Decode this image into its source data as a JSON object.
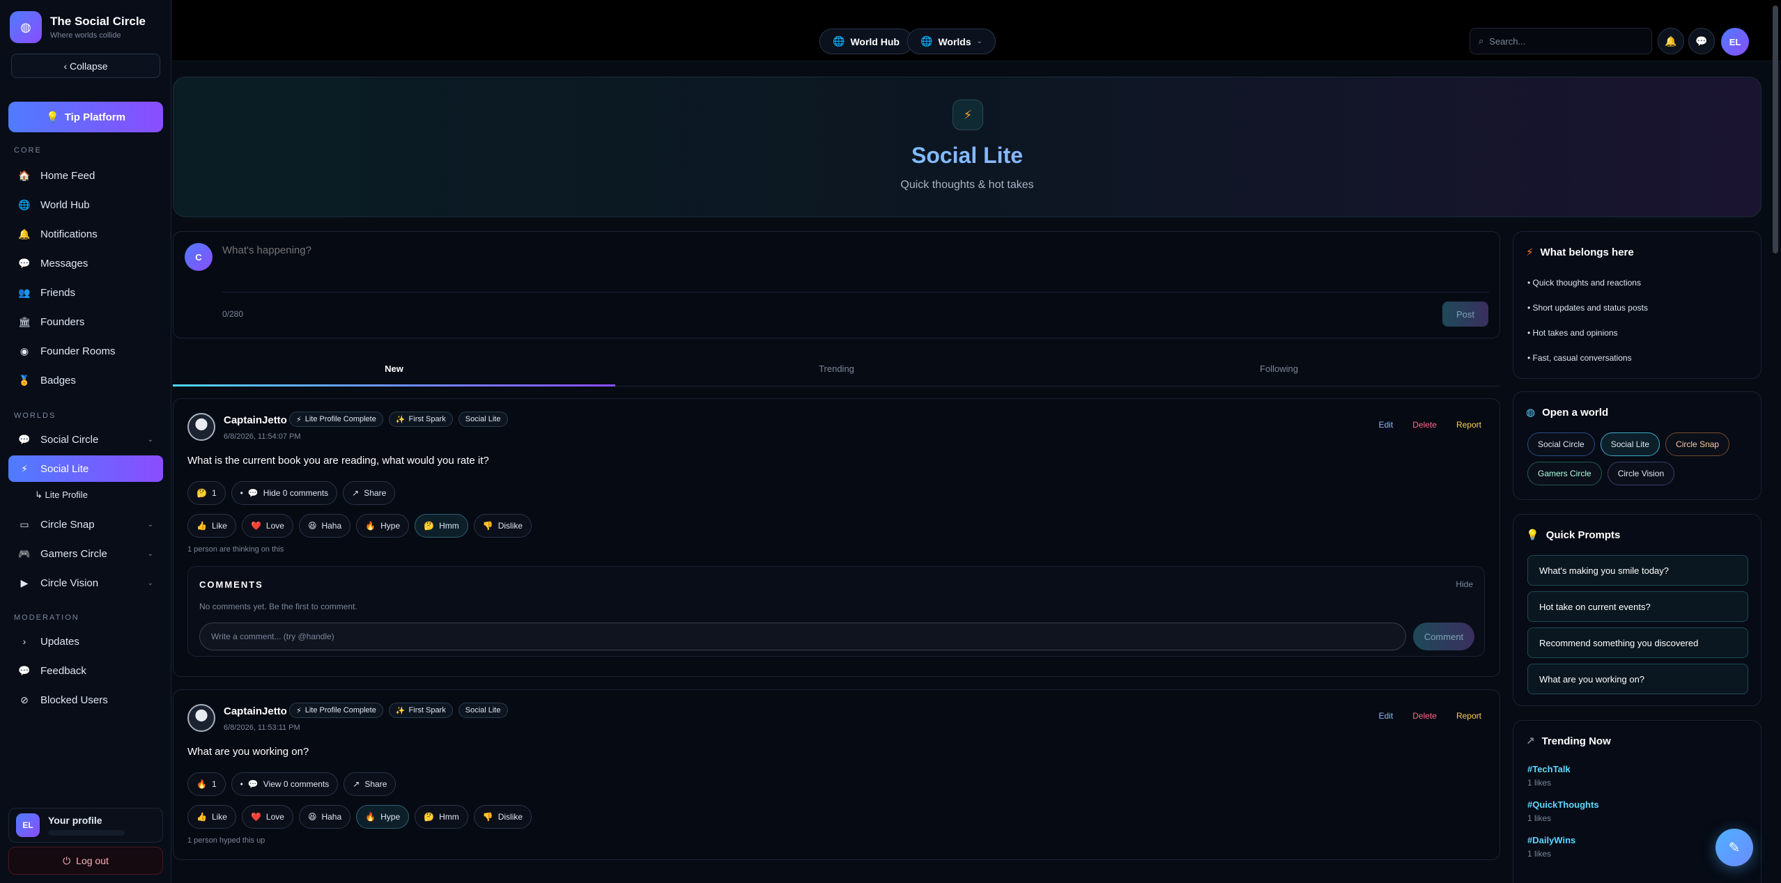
{
  "brand": {
    "title": "The Social Circle",
    "subtitle": "Where worlds collide"
  },
  "sidebar": {
    "collapse_label": "‹ Collapse",
    "tip_label": "Tip Platform",
    "sections": {
      "core": "CORE",
      "worlds": "WORLDS",
      "moderation": "MODERATION"
    },
    "core_items": [
      {
        "label": "Home Feed",
        "icon": "🏠"
      },
      {
        "label": "World Hub",
        "icon": "🌐"
      },
      {
        "label": "Notifications",
        "icon": "🔔"
      },
      {
        "label": "Messages",
        "icon": "💬"
      },
      {
        "label": "Friends",
        "icon": "👥"
      },
      {
        "label": "Founders",
        "icon": "🏛"
      },
      {
        "label": "Founder Rooms",
        "icon": "◉"
      },
      {
        "label": "Badges",
        "icon": "🏅"
      }
    ],
    "world_items": [
      {
        "label": "Social Circle",
        "icon": "💬"
      },
      {
        "label": "Social Lite",
        "icon": "⚡"
      },
      {
        "label": "Circle Snap",
        "icon": "▭"
      },
      {
        "label": "Gamers Circle",
        "icon": "🎮"
      },
      {
        "label": "Circle Vision",
        "icon": "▶"
      }
    ],
    "sub_item": "↳ Lite Profile",
    "mod_items": [
      {
        "label": "Updates",
        "icon": "›"
      },
      {
        "label": "Feedback",
        "icon": "💬"
      },
      {
        "label": "Blocked Users",
        "icon": "⊘"
      }
    ],
    "profile": {
      "initials": "EL",
      "label": "Your profile"
    },
    "logout_label": "Log out"
  },
  "topbar": {
    "world_hub": "World Hub",
    "worlds": "Worlds",
    "search_placeholder": "Search...",
    "avatar_initials": "EL"
  },
  "hero": {
    "title": "Social Lite",
    "subtitle": "Quick thoughts & hot takes"
  },
  "composer": {
    "avatar": "C",
    "placeholder": "What's happening?",
    "counter": "0/280",
    "post_label": "Post"
  },
  "tabs": [
    "New",
    "Trending",
    "Following"
  ],
  "posts": [
    {
      "author": "CaptainJetto",
      "badges": [
        "Lite Profile Complete",
        "First Spark",
        "Social Lite"
      ],
      "time": "6/8/2026, 11:54:07 PM",
      "actions": {
        "edit": "Edit",
        "delete": "Delete",
        "report": "Report"
      },
      "text": "What is the current book you are reading, what would you rate it?",
      "reaction_count": "1",
      "comments_toggle": "Hide 0 comments",
      "share": "Share",
      "reactions": [
        "Like",
        "Love",
        "Haha",
        "Hype",
        "Hmm",
        "Dislike"
      ],
      "meta": "1 person are thinking on this",
      "comments": {
        "title": "COMMENTS",
        "hide": "Hide",
        "empty": "No comments yet. Be the first to comment.",
        "placeholder": "Write a comment... (try @handle)",
        "button": "Comment"
      }
    },
    {
      "author": "CaptainJetto",
      "badges": [
        "Lite Profile Complete",
        "First Spark",
        "Social Lite"
      ],
      "time": "6/8/2026, 11:53:11 PM",
      "actions": {
        "edit": "Edit",
        "delete": "Delete",
        "report": "Report"
      },
      "text": "What are you working on?",
      "reaction_count": "1",
      "comments_toggle": "View 0 comments",
      "share": "Share",
      "reactions": [
        "Like",
        "Love",
        "Haha",
        "Hype",
        "Hmm",
        "Dislike"
      ],
      "meta": "1 person hyped this up"
    }
  ],
  "panels": {
    "belongs": {
      "title": "What belongs here",
      "items": [
        "• Quick thoughts and reactions",
        "• Short updates and status posts",
        "• Hot takes and opinions",
        "• Fast, casual conversations"
      ]
    },
    "open_world": {
      "title": "Open a world",
      "worlds": [
        "Social Circle",
        "Social Lite",
        "Circle Snap",
        "Gamers Circle",
        "Circle Vision"
      ]
    },
    "prompts": {
      "title": "Quick Prompts",
      "items": [
        "What's making you smile today?",
        "Hot take on current events?",
        "Recommend something you discovered",
        "What are you working on?"
      ]
    },
    "trending": {
      "title": "Trending Now",
      "items": [
        {
          "tag": "#TechTalk",
          "likes": "1 likes"
        },
        {
          "tag": "#QuickThoughts",
          "likes": "1 likes"
        },
        {
          "tag": "#DailyWins",
          "likes": "1 likes"
        }
      ]
    }
  },
  "colors": {
    "accent_start": "#4f7cff",
    "accent_end": "#8a4dff",
    "cyan": "#4fd8ff",
    "delete": "#ff6b8a",
    "report": "#ffd24a",
    "edit": "#8fb8ff"
  }
}
